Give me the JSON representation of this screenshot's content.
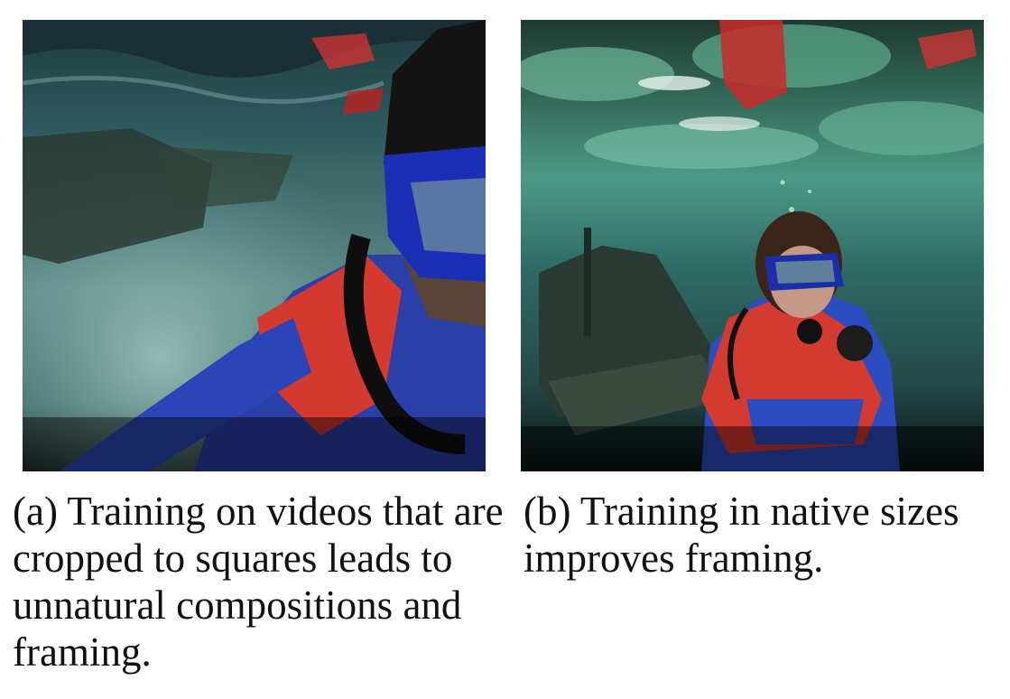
{
  "figure": {
    "panels": [
      {
        "id": "a",
        "image_alt": "underwater selfie of a diver in red and blue wetsuit, cropped square framing",
        "caption": "(a) Training on videos that are cropped to squares leads to unnatural compositions and framing."
      },
      {
        "id": "b",
        "image_alt": "diver swimming near a sunken ship, natural framing",
        "caption": "(b) Training in native sizes improves framing."
      }
    ]
  }
}
